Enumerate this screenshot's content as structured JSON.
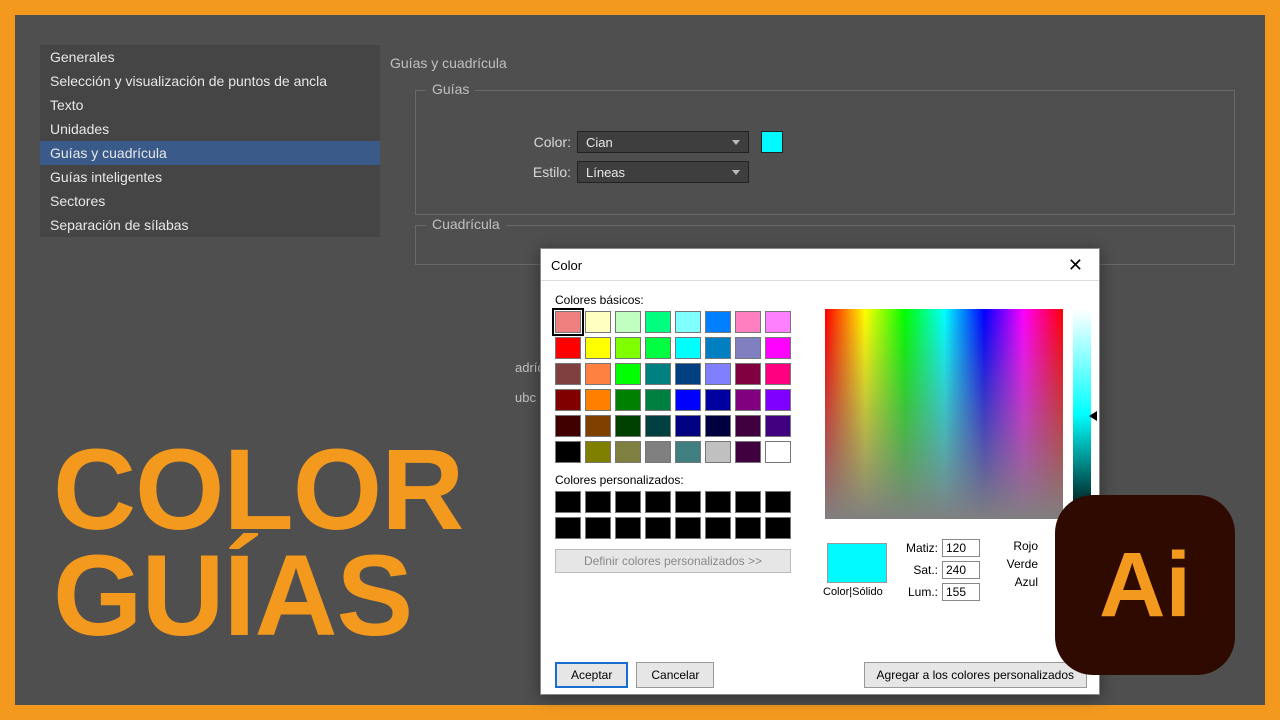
{
  "sidebar": {
    "items": [
      {
        "label": "Generales"
      },
      {
        "label": "Selección y visualización de puntos de ancla"
      },
      {
        "label": "Texto"
      },
      {
        "label": "Unidades"
      },
      {
        "label": "Guías y cuadrícula",
        "selected": true
      },
      {
        "label": "Guías inteligentes"
      },
      {
        "label": "Sectores"
      },
      {
        "label": "Separación de sílabas"
      }
    ]
  },
  "panel": {
    "title": "Guías y cuadrícula",
    "guides_section": "Guías",
    "grid_section": "Cuadrícula",
    "color_label": "Color:",
    "style_label": "Estilo:",
    "color_value": "Cian",
    "style_value": "Líneas",
    "swatch_color": "#00faff",
    "grid_label1": "adríc",
    "grid_label2": "ubc"
  },
  "headline": {
    "line1": "COLOR",
    "line2": "GUÍAS"
  },
  "color_dialog": {
    "title": "Color",
    "basic_label": "Colores básicos:",
    "custom_label": "Colores personalizados:",
    "define_btn": "Definir colores personalizados >>",
    "ok": "Aceptar",
    "cancel": "Cancelar",
    "preview_label": "Color|Sólido",
    "hue_label": "Matiz:",
    "sat_label": "Sat.:",
    "lum_label": "Lum.:",
    "red_label": "Rojo",
    "green_label": "Verde",
    "blue_label": "Azul",
    "hue": "120",
    "sat": "240",
    "lum": "155",
    "add_custom": "Agregar a los colores personalizados",
    "preview_color": "#00faff",
    "basic_colors": [
      "#f08080",
      "#ffffc0",
      "#c0ffc0",
      "#00ff80",
      "#80ffff",
      "#0080ff",
      "#ff80c0",
      "#ff80ff",
      "#ff0000",
      "#ffff00",
      "#80ff00",
      "#00ff40",
      "#00ffff",
      "#0080c0",
      "#8080c0",
      "#ff00ff",
      "#804040",
      "#ff8040",
      "#00ff00",
      "#008080",
      "#004080",
      "#8080ff",
      "#800040",
      "#ff0080",
      "#800000",
      "#ff8000",
      "#008000",
      "#008040",
      "#0000ff",
      "#0000a0",
      "#800080",
      "#8000ff",
      "#400000",
      "#804000",
      "#004000",
      "#004040",
      "#000080",
      "#000040",
      "#400040",
      "#400080",
      "#000000",
      "#808000",
      "#808040",
      "#808080",
      "#408080",
      "#c0c0c0",
      "#400040",
      "#ffffff"
    ],
    "selected_basic_index": 0,
    "custom_colors": [
      "#000000",
      "#000000",
      "#000000",
      "#000000",
      "#000000",
      "#000000",
      "#000000",
      "#000000",
      "#000000",
      "#000000",
      "#000000",
      "#000000",
      "#000000",
      "#000000",
      "#000000",
      "#000000"
    ]
  },
  "ai_badge": "Ai"
}
